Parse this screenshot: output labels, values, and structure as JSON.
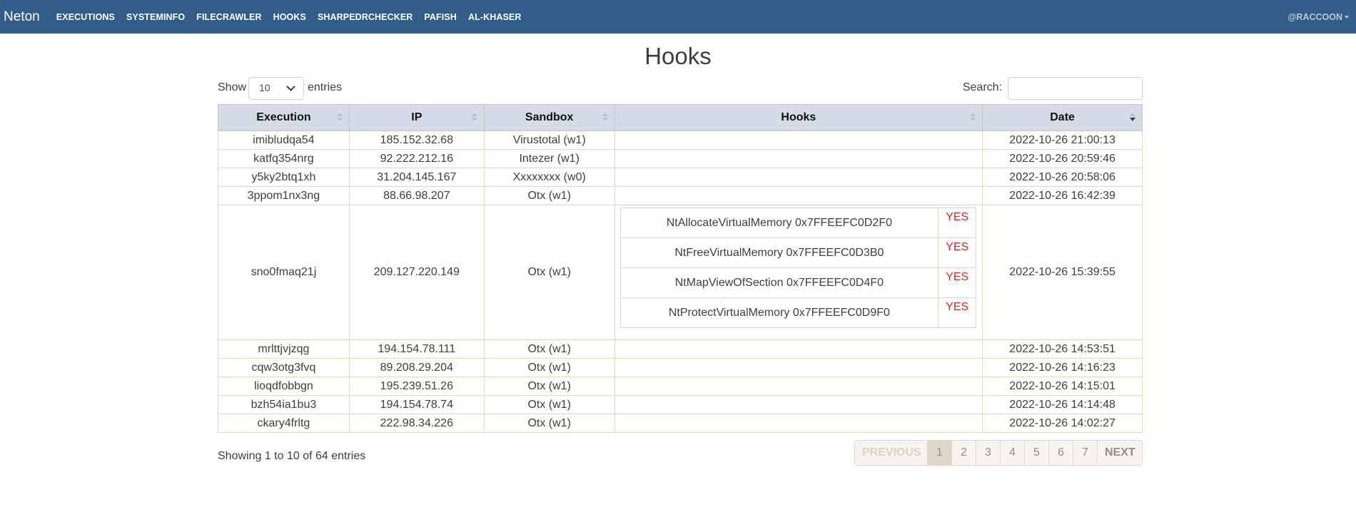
{
  "nav": {
    "brand": "Neton",
    "links": [
      "EXECUTIONS",
      "SYSTEMINFO",
      "FILECRAWLER",
      "HOOKS",
      "SHARPEDRCHECKER",
      "PAFISH",
      "AL-KHASER"
    ],
    "user": "@RACCOON"
  },
  "page": {
    "title": "Hooks"
  },
  "controls": {
    "show_label": "Show",
    "length_value": "10",
    "entries_label": "entries",
    "search_label": "Search:",
    "search_value": ""
  },
  "table": {
    "headers": [
      "Execution",
      "IP",
      "Sandbox",
      "Hooks",
      "Date"
    ],
    "sorted_column": "Date",
    "sort_direction": "desc",
    "rows": [
      {
        "execution": "imibludqa54",
        "ip": "185.152.32.68",
        "sandbox": "Virustotal (w1)",
        "hooks": [],
        "date": "2022-10-26 21:00:13"
      },
      {
        "execution": "katfq354nrg",
        "ip": "92.222.212.16",
        "sandbox": "Intezer (w1)",
        "hooks": [],
        "date": "2022-10-26 20:59:46"
      },
      {
        "execution": "y5ky2btq1xh",
        "ip": "31.204.145.167",
        "sandbox": "Xxxxxxxx (w0)",
        "hooks": [],
        "date": "2022-10-26 20:58:06"
      },
      {
        "execution": "3ppom1nx3ng",
        "ip": "88.66.98.207",
        "sandbox": "Otx (w1)",
        "hooks": [],
        "date": "2022-10-26 16:42:39"
      },
      {
        "execution": "sno0fmaq21j",
        "ip": "209.127.220.149",
        "sandbox": "Otx (w1)",
        "hooks": [
          {
            "name": "NtAllocateVirtualMemory 0x7FFEEFC0D2F0",
            "flag": "YES"
          },
          {
            "name": "NtFreeVirtualMemory 0x7FFEEFC0D3B0",
            "flag": "YES"
          },
          {
            "name": "NtMapViewOfSection 0x7FFEEFC0D4F0",
            "flag": "YES"
          },
          {
            "name": "NtProtectVirtualMemory 0x7FFEEFC0D9F0",
            "flag": "YES"
          }
        ],
        "date": "2022-10-26 15:39:55"
      },
      {
        "execution": "mrlttjvjzqg",
        "ip": "194.154.78.111",
        "sandbox": "Otx (w1)",
        "hooks": [],
        "date": "2022-10-26 14:53:51"
      },
      {
        "execution": "cqw3otg3fvq",
        "ip": "89.208.29.204",
        "sandbox": "Otx (w1)",
        "hooks": [],
        "date": "2022-10-26 14:16:23"
      },
      {
        "execution": "lioqdfobbgn",
        "ip": "195.239.51.26",
        "sandbox": "Otx (w1)",
        "hooks": [],
        "date": "2022-10-26 14:15:01"
      },
      {
        "execution": "bzh54ia1bu3",
        "ip": "194.154.78.74",
        "sandbox": "Otx (w1)",
        "hooks": [],
        "date": "2022-10-26 14:14:48"
      },
      {
        "execution": "ckary4frltg",
        "ip": "222.98.34.226",
        "sandbox": "Otx (w1)",
        "hooks": [],
        "date": "2022-10-26 14:02:27"
      }
    ]
  },
  "footer": {
    "info": "Showing 1 to 10 of 64 entries",
    "previous": "PREVIOUS",
    "next": "NEXT",
    "pages": [
      "1",
      "2",
      "3",
      "4",
      "5",
      "6",
      "7"
    ],
    "current_page": "1"
  },
  "colors": {
    "navbar": "#325d88",
    "header_bg": "#d4dce8",
    "flag_red": "#d9241c"
  }
}
